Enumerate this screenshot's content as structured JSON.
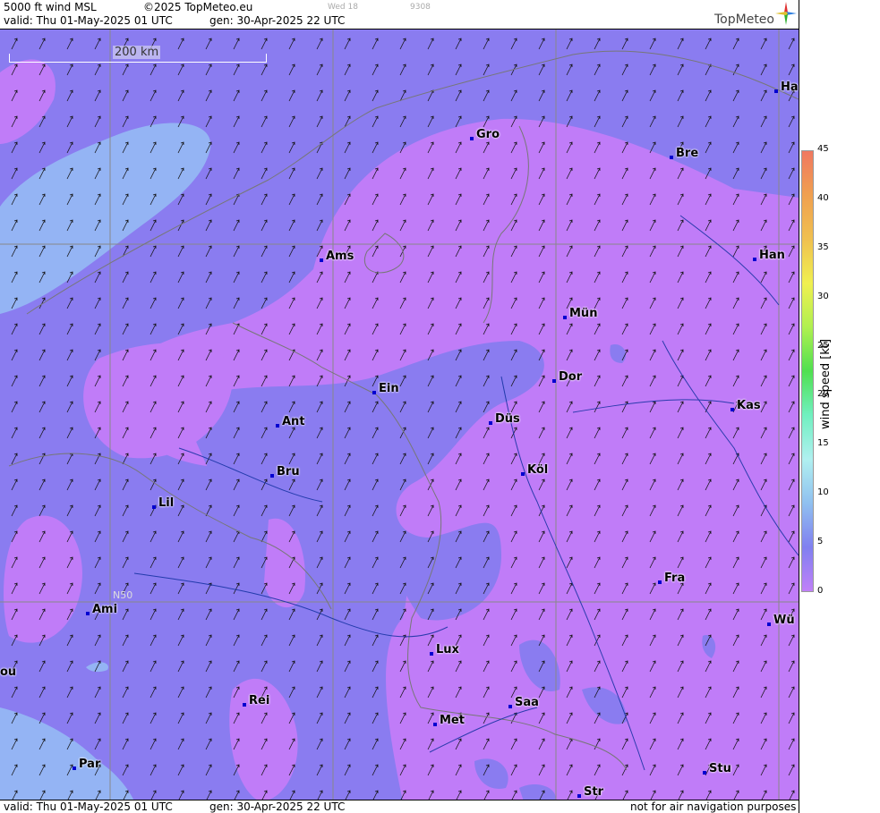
{
  "header": {
    "title": "5000 ft wind MSL",
    "copyright": "©2025 TopMeteo.eu",
    "valid": "valid:  Thu  01-May-2025  01 UTC",
    "gen": "gen: 30-Apr-2025 22 UTC",
    "faint1": "Wed 18",
    "faint2": "9308",
    "logo": "TopMeteo"
  },
  "footer": {
    "valid": "valid:  Thu  01-May-2025  01 UTC",
    "gen": "gen: 30-Apr-2025 22 UTC",
    "note": "not for air navigation purposes"
  },
  "map": {
    "scale_label": "200 km",
    "lat_label": "N50",
    "cities": [
      {
        "name": "Ha"
      },
      {
        "name": "Gro"
      },
      {
        "name": "Bre"
      },
      {
        "name": "Ams"
      },
      {
        "name": "Han"
      },
      {
        "name": "Mün"
      },
      {
        "name": "Ein"
      },
      {
        "name": "Dor"
      },
      {
        "name": "Ant"
      },
      {
        "name": "Düs"
      },
      {
        "name": "Kas"
      },
      {
        "name": "Bru"
      },
      {
        "name": "Köl"
      },
      {
        "name": "Lil"
      },
      {
        "name": "Fra"
      },
      {
        "name": "Ami"
      },
      {
        "name": "Wü"
      },
      {
        "name": "Lux"
      },
      {
        "name": "ou"
      },
      {
        "name": "Rei"
      },
      {
        "name": "Saa"
      },
      {
        "name": "Met"
      },
      {
        "name": "Par"
      },
      {
        "name": "Stu"
      },
      {
        "name": "Str"
      }
    ]
  },
  "legend": {
    "axis_label": "wind speed [kt]",
    "ticks": [
      "45",
      "40",
      "35",
      "30",
      "25",
      "20",
      "15",
      "10",
      "5",
      "0"
    ],
    "colors": [
      "#f07860",
      "#f0a050",
      "#f0c050",
      "#f0f050",
      "#b0f050",
      "#50e050",
      "#70f0c0",
      "#b0f0f0",
      "#90c0f0",
      "#8080f0",
      "#c080f8"
    ]
  }
}
